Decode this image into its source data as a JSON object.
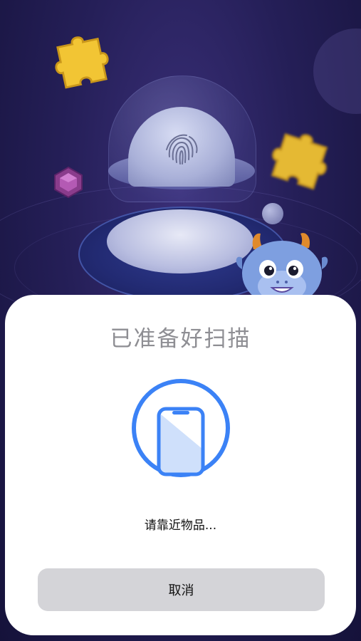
{
  "scan_sheet": {
    "title": "已准备好扫描",
    "status": "请靠近物品...",
    "cancel_label": "取消"
  },
  "colors": {
    "accent": "#3b82f6",
    "sheet_bg": "#ffffff",
    "title_gray": "#8e8e93",
    "cancel_bg": "#d4d4d8",
    "background_dark": "#251f58"
  },
  "icons": {
    "scan": "phone-scan-icon",
    "fingerprint": "fingerprint-icon"
  }
}
